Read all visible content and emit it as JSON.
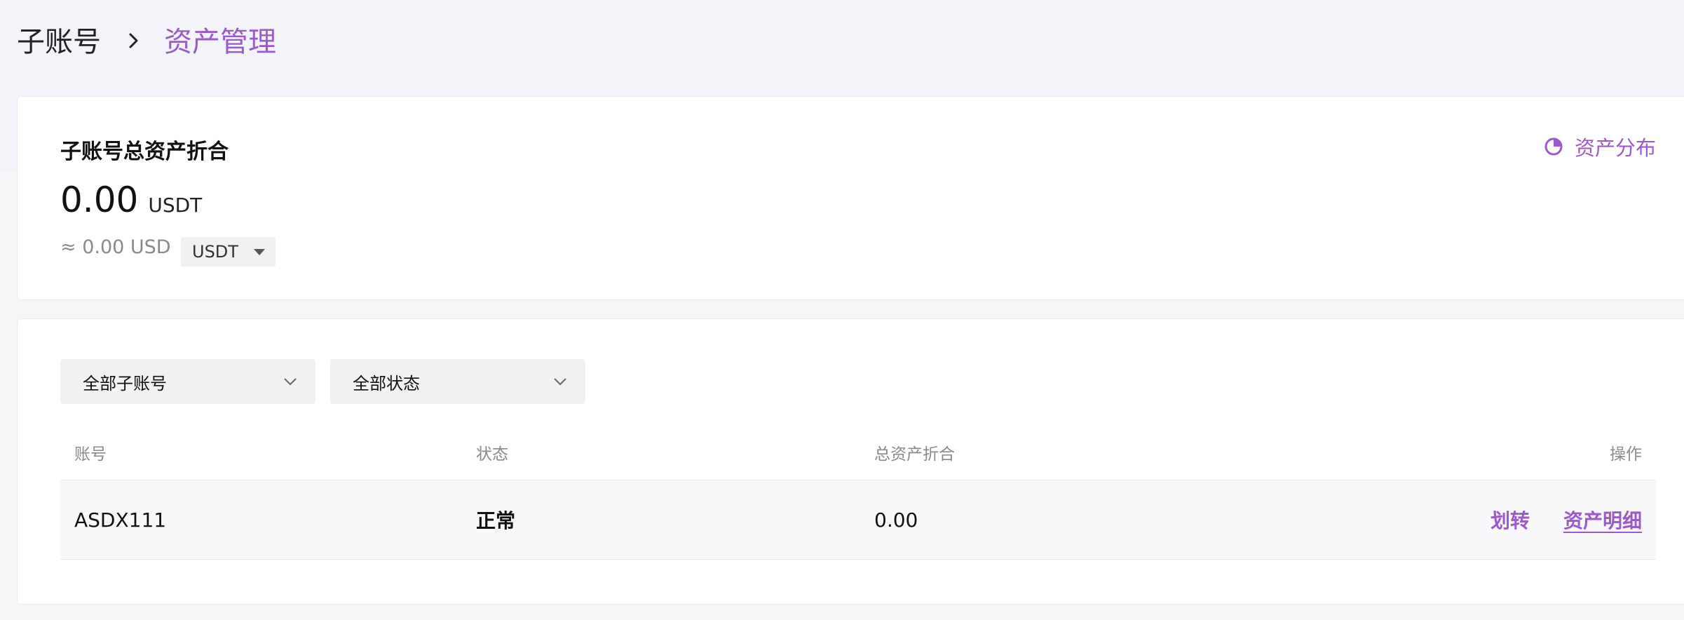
{
  "breadcrumb": {
    "root": "子账号",
    "current": "资产管理"
  },
  "summary": {
    "title": "子账号总资产折合",
    "amount": "0.00",
    "unit": "USDT",
    "approx": "≈ 0.00 USD",
    "currency_select": "USDT",
    "distribution_link": "资产分布"
  },
  "filters": {
    "subaccount": "全部子账号",
    "status": "全部状态"
  },
  "table": {
    "headers": {
      "account": "账号",
      "status": "状态",
      "total": "总资产折合",
      "actions": "操作"
    },
    "rows": [
      {
        "account": "ASDX111",
        "status": "正常",
        "total": "0.00",
        "transfer": "划转",
        "detail": "资产明细"
      }
    ]
  },
  "colors": {
    "accent": "#9b59c9",
    "background": "#f6f6f9",
    "card": "#ffffff"
  }
}
